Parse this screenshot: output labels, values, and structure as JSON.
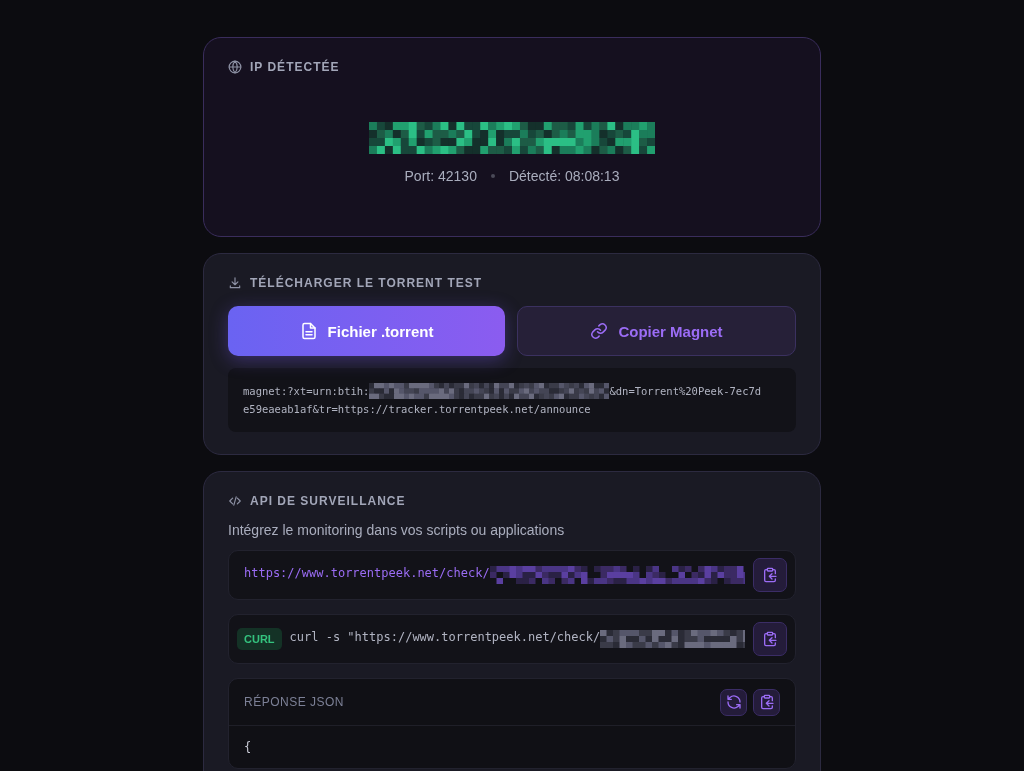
{
  "ip_card": {
    "title": "IP DÉTECTÉE",
    "port": "Port: 42130",
    "detected": "Détecté: 08:08:13"
  },
  "download": {
    "title": "TÉLÉCHARGER LE TORRENT TEST",
    "buttons": [
      {
        "label": "Fichier .torrent",
        "kind": "primary"
      },
      {
        "label": "Copier Magnet",
        "kind": "secondary"
      }
    ],
    "magnet_lines": [
      {
        "before": "magnet:?xt=urn:btih:",
        "after": "&dn=Torrent%20Peek-7ec7d"
      },
      {
        "before": "e59eaeab1af&tr=https://tracker.torrentpeek.net/announce"
      }
    ]
  },
  "api": {
    "title": "API DE SURVEILLANCE",
    "description": "Intégrez le monitoring dans vos scripts ou applications",
    "endpoints": [
      {
        "kind": "url",
        "text": "https://www.torrentpeek.net/check/"
      },
      {
        "kind": "curl",
        "badge": "CURL",
        "text": "curl -s \"https://www.torrentpeek.net/check/"
      }
    ],
    "response": {
      "title": "RÉPONSE JSON",
      "lines": [
        "{"
      ]
    }
  }
}
